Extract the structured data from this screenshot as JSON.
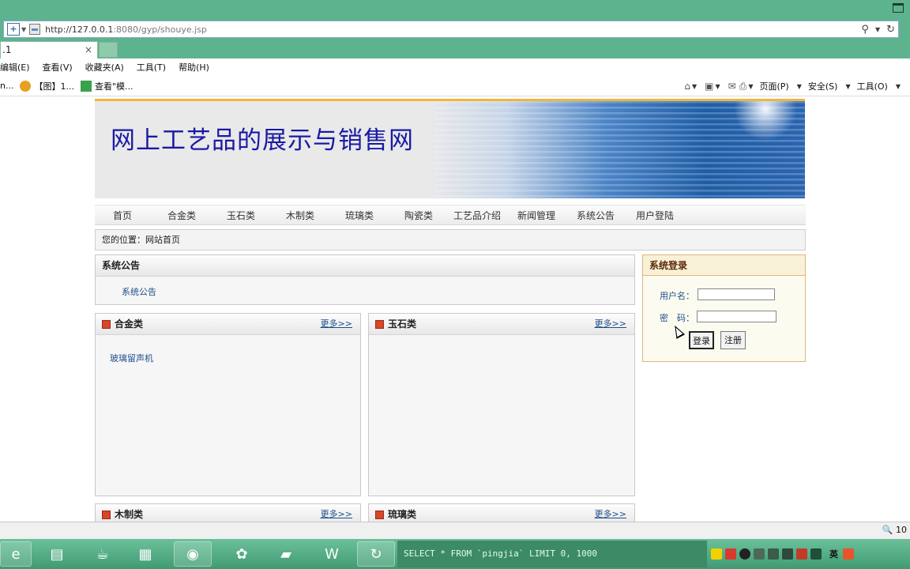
{
  "browser": {
    "url_prefix": "http://127.0.0.1",
    "url_rest": ":8080/gyp/shouye.jsp",
    "tab_title": ".1",
    "tab_close": "×",
    "menus": [
      "编辑(E)",
      "查看(V)",
      "收藏夹(A)",
      "工具(T)",
      "帮助(H)"
    ],
    "favorites": [
      {
        "label": "n...",
        "icon": "ie-icon"
      },
      {
        "label": "【图】1...",
        "icon": "snapshot-icon"
      },
      {
        "label": "查看\"模...",
        "icon": "page-icon"
      }
    ],
    "commands": {
      "page": "页面(P)",
      "safety": "安全(S)",
      "tools": "工具(O)"
    },
    "zoom": "10"
  },
  "site": {
    "title": "网上工艺品的展示与销售网",
    "nav": [
      "首页",
      "合金类",
      "玉石类",
      "木制类",
      "琉璃类",
      "陶瓷类",
      "工艺品介绍",
      "新闻管理",
      "系统公告",
      "用户登陆"
    ],
    "breadcrumb": "您的位置：网站首页",
    "notice": {
      "title": "系统公告",
      "link": "系统公告"
    },
    "categories": [
      {
        "title": "合金类",
        "more": "更多>>",
        "items": [
          "玻璃留声机"
        ]
      },
      {
        "title": "玉石类",
        "more": "更多>>",
        "items": []
      },
      {
        "title": "木制类",
        "more": "更多>>",
        "items": []
      },
      {
        "title": "琉璃类",
        "more": "更多>>",
        "items": []
      }
    ],
    "login": {
      "title": "系统登录",
      "username_label": "用户名：",
      "password_label": "密　码：",
      "login_button": "登录",
      "register_button": "注册"
    }
  },
  "taskbar": {
    "console_text": "SELECT * FROM `pingjia` LIMIT 0, 1000",
    "tray_label": "英"
  }
}
